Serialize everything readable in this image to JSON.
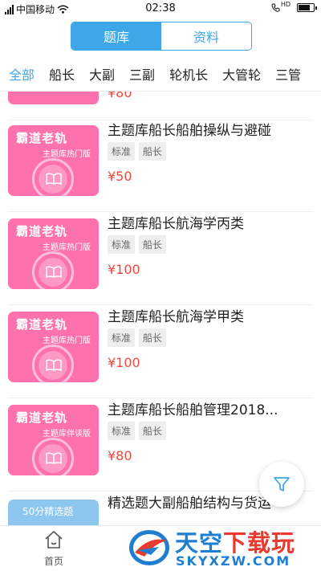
{
  "status_bar": {
    "carrier": "中国移动",
    "time": "02:38",
    "network": "HD"
  },
  "segment": {
    "tabs": [
      {
        "label": "题库",
        "active": true
      },
      {
        "label": "资料",
        "active": false
      }
    ]
  },
  "category_tabs": [
    "全部",
    "船长",
    "大副",
    "三副",
    "轮机长",
    "大管轮",
    "三管"
  ],
  "list": {
    "partial_top_price": "¥80",
    "items": [
      {
        "title": "主题库船长船舶操纵与避碰",
        "tags": [
          "标准",
          "船长"
        ],
        "price": "¥50",
        "thumb_title": "霸道老轨",
        "thumb_sub": "主题库热门版"
      },
      {
        "title": "主题库船长航海学丙类",
        "tags": [
          "标准",
          "船长"
        ],
        "price": "¥100",
        "thumb_title": "霸道老轨",
        "thumb_sub": "主题库热门版"
      },
      {
        "title": "主题库船长航海学甲类",
        "tags": [
          "标准",
          "船长"
        ],
        "price": "¥100",
        "thumb_title": "霸道老轨",
        "thumb_sub": "主题库热门版"
      },
      {
        "title": "主题库船长船舶管理2018...",
        "tags": [
          "标准",
          "船长"
        ],
        "price": "¥80",
        "thumb_title": "霸道老轨",
        "thumb_sub": "主题库伴读版"
      },
      {
        "title": "精选题大副船舶结构与货运",
        "thumb_title": "50分精选题"
      }
    ]
  },
  "bottom_nav": {
    "home_label": "首页"
  },
  "watermark": {
    "title_blue": "天空",
    "title_red": "下载玩",
    "domain": "SKYXZW.COM"
  },
  "colors": {
    "accent": "#3da7e8",
    "thumb_pink": "#fe71ad",
    "thumb_blue": "#8dc7ef",
    "price_red": "#e94b3c"
  }
}
